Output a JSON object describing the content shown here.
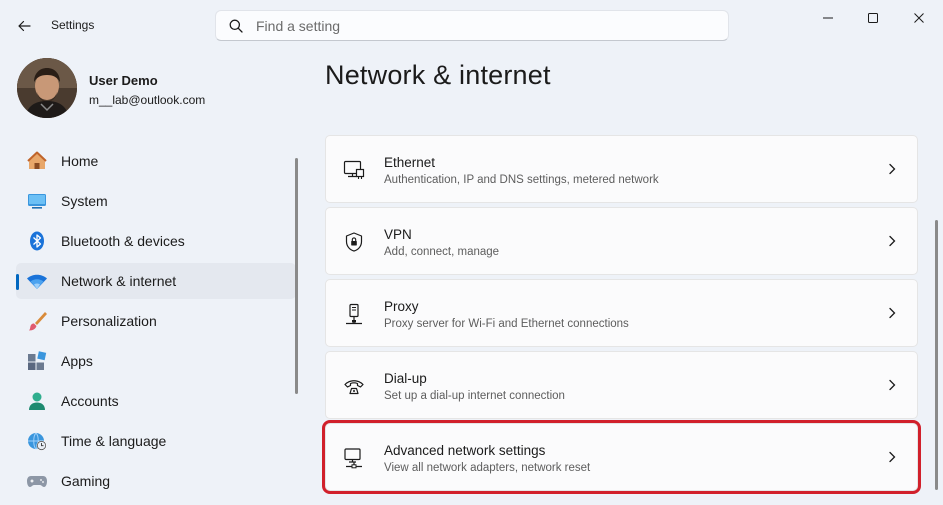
{
  "app": {
    "title": "Settings"
  },
  "search": {
    "placeholder": "Find a setting"
  },
  "profile": {
    "name": "User Demo",
    "email": "m__lab@outlook.com"
  },
  "sidebar": {
    "items": [
      {
        "label": "Home",
        "icon": "home-icon",
        "selected": false
      },
      {
        "label": "System",
        "icon": "system-icon",
        "selected": false
      },
      {
        "label": "Bluetooth & devices",
        "icon": "bluetooth-icon",
        "selected": false
      },
      {
        "label": "Network & internet",
        "icon": "wifi-icon",
        "selected": true
      },
      {
        "label": "Personalization",
        "icon": "brush-icon",
        "selected": false
      },
      {
        "label": "Apps",
        "icon": "apps-icon",
        "selected": false
      },
      {
        "label": "Accounts",
        "icon": "accounts-icon",
        "selected": false
      },
      {
        "label": "Time & language",
        "icon": "globe-clock-icon",
        "selected": false
      },
      {
        "label": "Gaming",
        "icon": "gamepad-icon",
        "selected": false
      }
    ]
  },
  "main": {
    "title": "Network & internet",
    "cards": [
      {
        "title": "Ethernet",
        "subtitle": "Authentication, IP and DNS settings, metered network",
        "icon": "ethernet-icon"
      },
      {
        "title": "VPN",
        "subtitle": "Add, connect, manage",
        "icon": "vpn-shield-icon"
      },
      {
        "title": "Proxy",
        "subtitle": "Proxy server for Wi-Fi and Ethernet connections",
        "icon": "proxy-icon"
      },
      {
        "title": "Dial-up",
        "subtitle": "Set up a dial-up internet connection",
        "icon": "dialup-phone-icon"
      },
      {
        "title": "Advanced network settings",
        "subtitle": "View all network adapters, network reset",
        "icon": "advanced-network-icon",
        "highlighted": true
      }
    ]
  },
  "colors": {
    "accent": "#0067c0",
    "highlight_border": "#d1202b",
    "background": "#eef2f8"
  }
}
